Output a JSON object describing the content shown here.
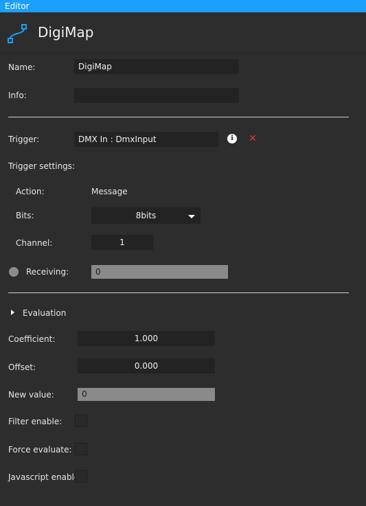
{
  "window": {
    "title": "Editor"
  },
  "header": {
    "title": "DigiMap",
    "icon": "node-link-icon",
    "accent": "#1a9ffb"
  },
  "name": {
    "label": "Name:",
    "value": "DigiMap"
  },
  "info": {
    "label": "Info:",
    "value": ""
  },
  "trigger": {
    "label": "Trigger:",
    "value": "DMX In : DmxInput",
    "info_icon": "i",
    "remove_icon": "✕"
  },
  "trigger_settings": {
    "label": "Trigger settings:",
    "action_label": "Action:",
    "action_value": "Message",
    "bits_label": "Bits:",
    "bits_value": "8bits",
    "channel_label": "Channel:",
    "channel_value": "1",
    "receiving_label": "Receiving:",
    "receiving_value": "0"
  },
  "evaluation": {
    "label": "Evaluation",
    "coefficient_label": "Coefficient:",
    "coefficient_value": "1.000",
    "offset_label": "Offset:",
    "offset_value": "0.000",
    "new_value_label": "New value:",
    "new_value": "0",
    "filter_label": "Filter enable:",
    "force_label": "Force evaluate:",
    "javascript_label": "Javascript enable:"
  }
}
